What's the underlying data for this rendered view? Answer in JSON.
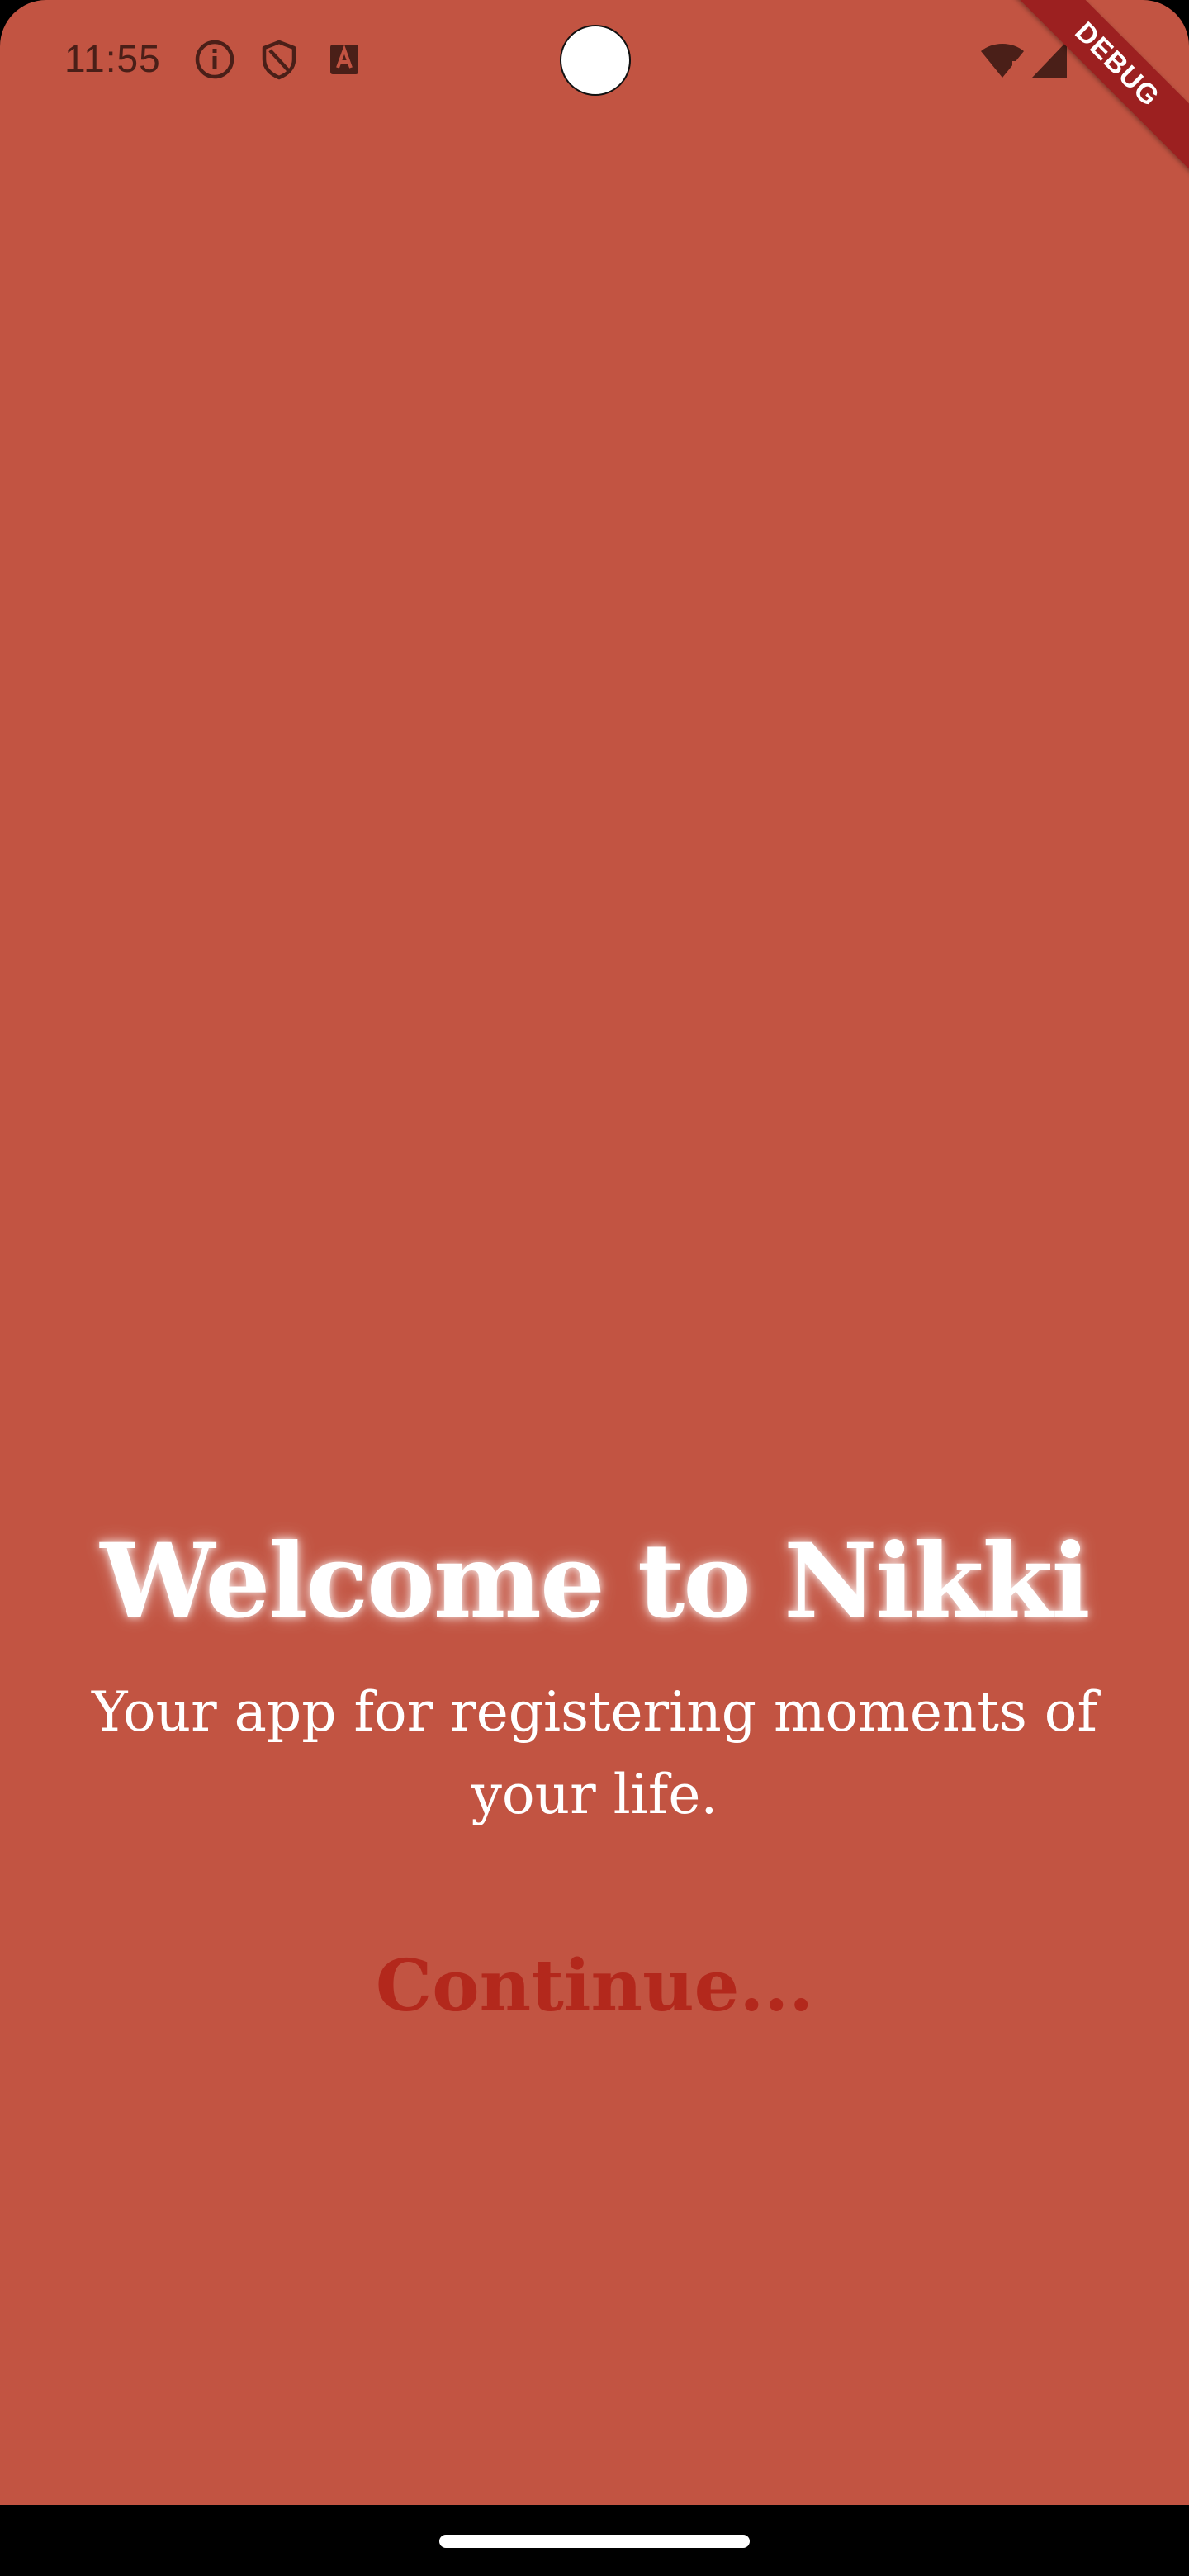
{
  "status_bar": {
    "time": "11:55",
    "icons_left": [
      "info-icon",
      "shield-icon",
      "text-a-icon"
    ],
    "icons_right": [
      "wifi-icon",
      "signal-icon"
    ]
  },
  "debug_banner": {
    "label": "DEBUG",
    "color": "#9c2020"
  },
  "welcome": {
    "title": "Welcome to Nikki",
    "subtitle": "Your app for registering moments of your life.",
    "continue_label": "Continue..."
  },
  "colors": {
    "background": "#c25442",
    "title": "#ffffff",
    "continue": "#b3281c"
  }
}
